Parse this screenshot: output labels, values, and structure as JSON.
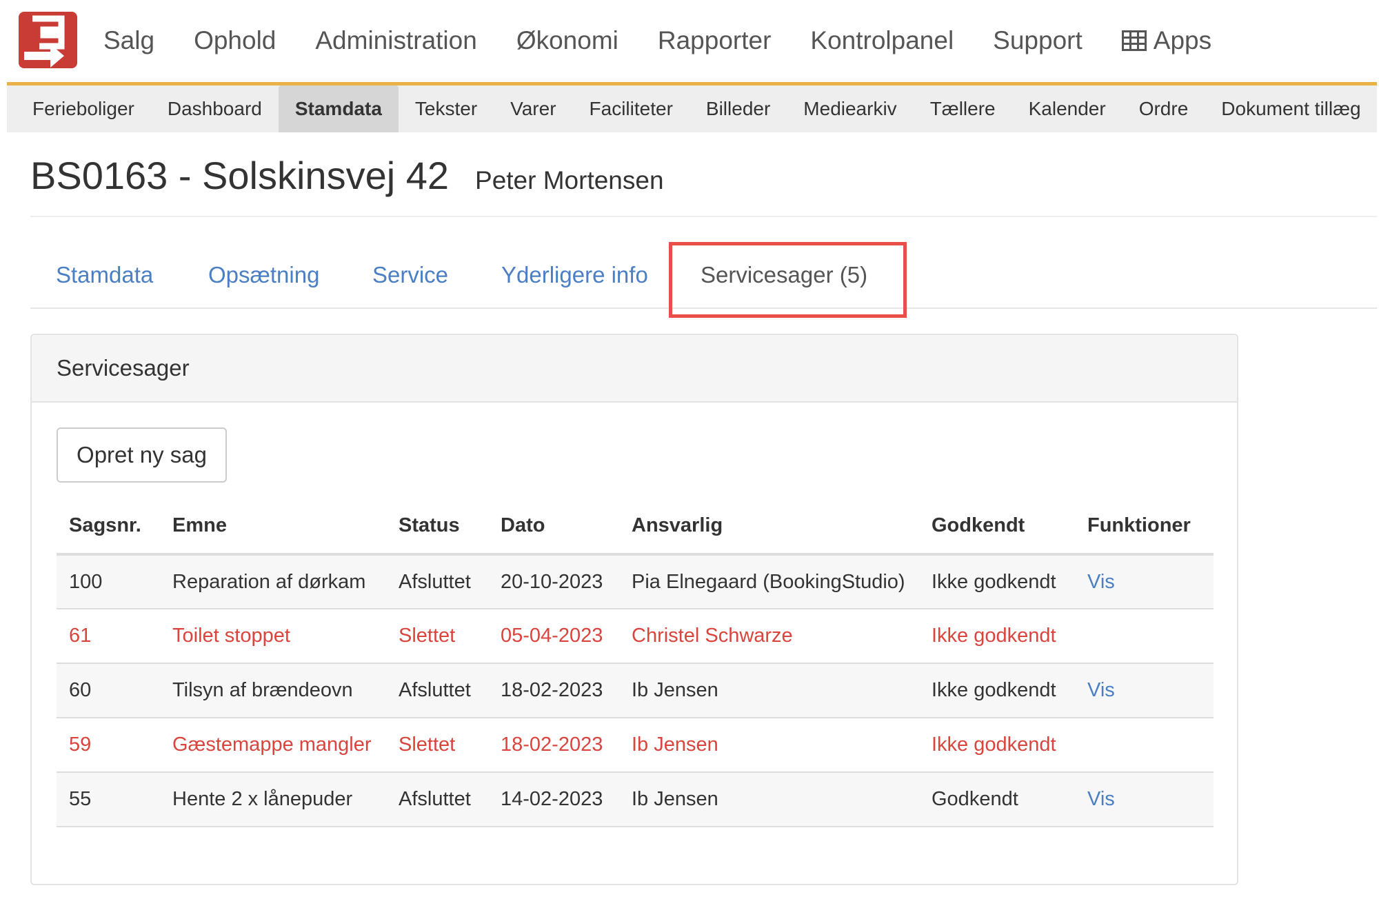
{
  "colors": {
    "accent_bar": "#e8b247",
    "brand_red": "#c93b35",
    "link_blue": "#4a7fc4",
    "deleted_red": "#d9453d",
    "highlight_box": "#e94f48"
  },
  "top_menu": {
    "items": [
      "Salg",
      "Ophold",
      "Administration",
      "Økonomi",
      "Rapporter",
      "Kontrolpanel",
      "Support"
    ],
    "apps_label": "Apps",
    "apps_icon": "grid-icon"
  },
  "sub_nav": {
    "items": [
      "Ferieboliger",
      "Dashboard",
      "Stamdata",
      "Tekster",
      "Varer",
      "Faciliteter",
      "Billeder",
      "Mediearkiv",
      "Tællere",
      "Kalender",
      "Ordre",
      "Dokument tillæg"
    ],
    "active": "Stamdata"
  },
  "page": {
    "title": "BS0163 - Solskinsvej 42",
    "owner": "Peter Mortensen"
  },
  "tabs": {
    "items": [
      "Stamdata",
      "Opsætning",
      "Service",
      "Yderligere info",
      "Servicesager (5)"
    ],
    "active": "Servicesager (5)"
  },
  "panel": {
    "title": "Servicesager",
    "new_button": "Opret ny sag",
    "columns": [
      "Sagsnr.",
      "Emne",
      "Status",
      "Dato",
      "Ansvarlig",
      "Godkendt",
      "Funktioner"
    ],
    "rows": [
      {
        "nr": "100",
        "emne": "Reparation af dørkam",
        "status": "Afsluttet",
        "dato": "20-10-2023",
        "ansvarlig": "Pia Elnegaard (BookingStudio)",
        "godkendt": "Ikke godkendt",
        "funktion": "Vis"
      },
      {
        "nr": "61",
        "emne": "Toilet stoppet",
        "status": "Slettet",
        "dato": "05-04-2023",
        "ansvarlig": "Christel Schwarze",
        "godkendt": "Ikke godkendt",
        "funktion": ""
      },
      {
        "nr": "60",
        "emne": "Tilsyn af brændeovn",
        "status": "Afsluttet",
        "dato": "18-02-2023",
        "ansvarlig": "Ib Jensen",
        "godkendt": "Ikke godkendt",
        "funktion": "Vis"
      },
      {
        "nr": "59",
        "emne": "Gæstemappe mangler",
        "status": "Slettet",
        "dato": "18-02-2023",
        "ansvarlig": "Ib Jensen",
        "godkendt": "Ikke godkendt",
        "funktion": ""
      },
      {
        "nr": "55",
        "emne": "Hente 2 x lånepuder",
        "status": "Afsluttet",
        "dato": "14-02-2023",
        "ansvarlig": "Ib Jensen",
        "godkendt": "Godkendt",
        "funktion": "Vis"
      }
    ]
  }
}
